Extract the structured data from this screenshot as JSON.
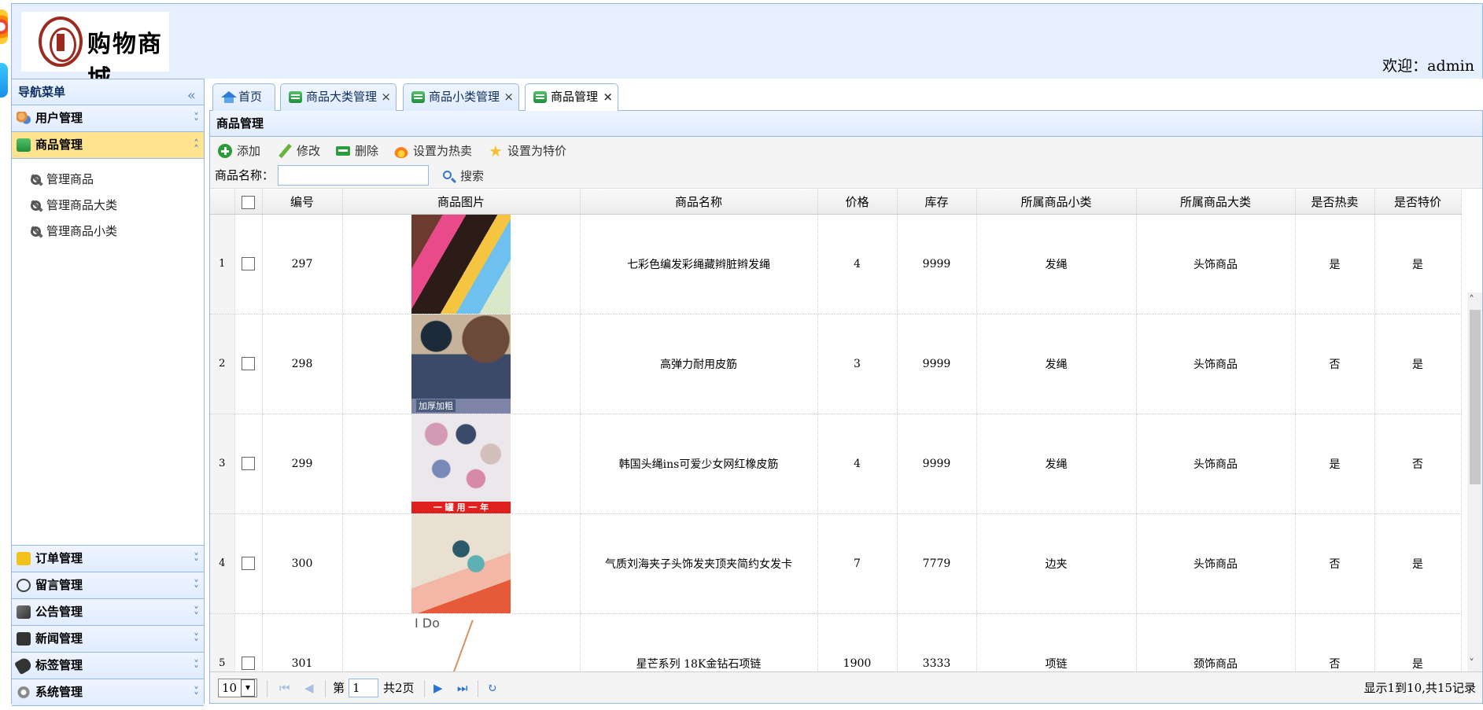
{
  "header": {
    "logo_text": "购物商城",
    "welcome": "欢迎：admin"
  },
  "sidebar": {
    "title": "导航菜单",
    "panels_top": [
      {
        "label": "用户管理",
        "icon": "users-icon",
        "color": "#e48a3a"
      },
      {
        "label": "商品管理",
        "icon": "goods-icon",
        "color": "#2a9d3a",
        "active": true
      }
    ],
    "sub_items": [
      "管理商品",
      "管理商品大类",
      "管理商品小类"
    ],
    "panels_bottom": [
      {
        "label": "订单管理",
        "icon": "order-icon",
        "color": "#f2c21b"
      },
      {
        "label": "留言管理",
        "icon": "message-icon",
        "color": "#444"
      },
      {
        "label": "公告管理",
        "icon": "notice-icon",
        "color": "#555"
      },
      {
        "label": "新闻管理",
        "icon": "news-icon",
        "color": "#333"
      },
      {
        "label": "标签管理",
        "icon": "tag-icon",
        "color": "#333"
      },
      {
        "label": "系统管理",
        "icon": "gear-icon",
        "color": "#888"
      }
    ]
  },
  "tabs": [
    {
      "label": "首页",
      "closable": false
    },
    {
      "label": "商品大类管理",
      "closable": true
    },
    {
      "label": "商品小类管理",
      "closable": true
    },
    {
      "label": "商品管理",
      "closable": true,
      "selected": true
    }
  ],
  "tab_close": "×",
  "panel": {
    "title": "商品管理",
    "toolbar": {
      "add": "添加",
      "edit": "修改",
      "delete": "删除",
      "set_hot": "设置为热卖",
      "set_special": "设置为特价"
    },
    "search": {
      "label": "商品名称：",
      "value": "",
      "button": "搜索"
    }
  },
  "grid": {
    "columns": [
      "编号",
      "商品图片",
      "商品名称",
      "价格",
      "库存",
      "所属商品小类",
      "所属商品大类",
      "是否热卖",
      "是否特价"
    ],
    "rows": [
      {
        "rn": "1",
        "id": "297",
        "name": "七彩色编发彩绳藏辫脏辫发绳",
        "price": "4",
        "stock": "9999",
        "sub": "发绳",
        "cat": "头饰商品",
        "hot": "是",
        "special": "是"
      },
      {
        "rn": "2",
        "id": "298",
        "name": "高弹力耐用皮筋",
        "price": "3",
        "stock": "9999",
        "sub": "发绳",
        "cat": "头饰商品",
        "hot": "否",
        "special": "是"
      },
      {
        "rn": "3",
        "id": "299",
        "name": "韩国头绳ins可爱少女网红橡皮筋",
        "price": "4",
        "stock": "9999",
        "sub": "发绳",
        "cat": "头饰商品",
        "hot": "是",
        "special": "否"
      },
      {
        "rn": "4",
        "id": "300",
        "name": "气质刘海夹子头饰发夹顶夹简约女发卡",
        "price": "7",
        "stock": "7779",
        "sub": "边夹",
        "cat": "头饰商品",
        "hot": "否",
        "special": "是"
      },
      {
        "rn": "5",
        "id": "301",
        "name": "星芒系列 18K金钻石项链",
        "price": "1900",
        "stock": "3333",
        "sub": "项链",
        "cat": "颈饰商品",
        "hot": "否",
        "special": "是"
      }
    ],
    "image_texts": {
      "img2": "加厚加粗",
      "img3": "一 罐 用 一 年",
      "img5": "I Do"
    }
  },
  "pager": {
    "page_size": "10",
    "page_prefix": "第",
    "page_value": "1",
    "page_suffix": "共2页",
    "info": "显示1到10,共15记录"
  }
}
